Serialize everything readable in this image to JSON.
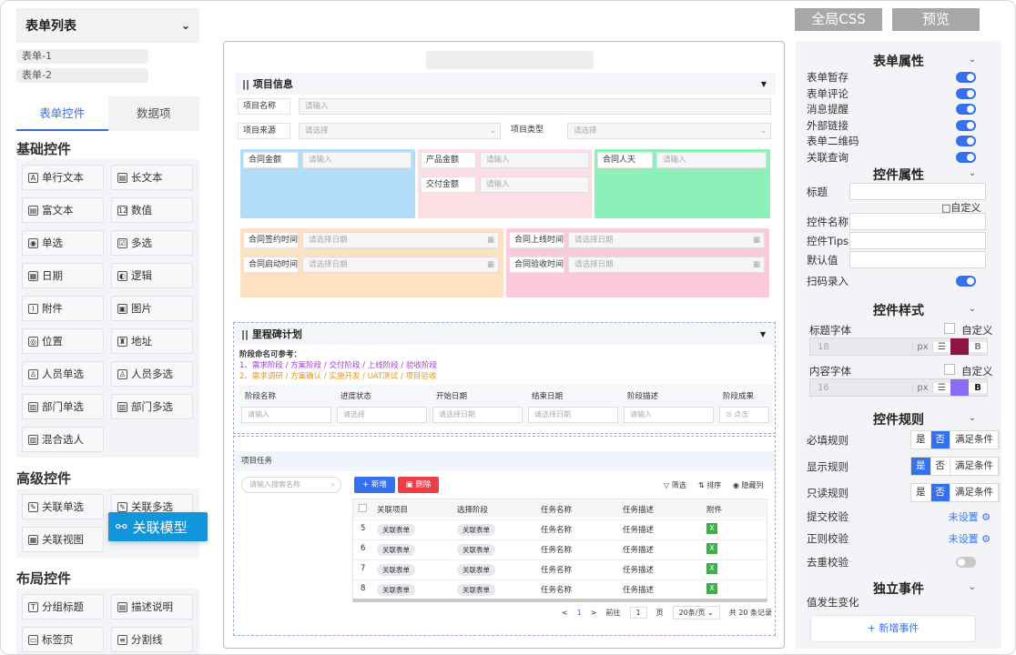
{
  "left": {
    "title": "表单列表",
    "forms": [
      "表单-1",
      "表单-2"
    ],
    "tabs": [
      "表单控件",
      "数据项"
    ],
    "basic_title": "基础控件",
    "basic": [
      {
        "label": "单行文本",
        "icon": "A"
      },
      {
        "label": "长文本",
        "icon": "▤"
      },
      {
        "label": "富文本",
        "icon": "▤"
      },
      {
        "label": "数值",
        "icon": "12"
      },
      {
        "label": "单选",
        "icon": "◉"
      },
      {
        "label": "多选",
        "icon": "☑"
      },
      {
        "label": "日期",
        "icon": "▦"
      },
      {
        "label": "逻辑",
        "icon": "◐"
      },
      {
        "label": "附件",
        "icon": "⌇"
      },
      {
        "label": "图片",
        "icon": "▣"
      },
      {
        "label": "位置",
        "icon": "◎"
      },
      {
        "label": "地址",
        "icon": "♜"
      },
      {
        "label": "人员单选",
        "icon": "♙"
      },
      {
        "label": "人员多选",
        "icon": "♙"
      },
      {
        "label": "部门单选",
        "icon": "▥"
      },
      {
        "label": "部门多选",
        "icon": "▥"
      },
      {
        "label": "混合选人",
        "icon": "▥"
      }
    ],
    "adv_title": "高级控件",
    "advanced": [
      {
        "label": "关联单选",
        "icon": "✎"
      },
      {
        "label": "关联多选",
        "icon": "✎"
      },
      {
        "label": "关联视图",
        "icon": "▦"
      }
    ],
    "dragging": "关联模型",
    "layout_title": "布局控件",
    "layout": [
      {
        "label": "分组标题",
        "icon": "T"
      },
      {
        "label": "描述说明",
        "icon": "▤"
      },
      {
        "label": "标签页",
        "icon": "▭"
      },
      {
        "label": "分割线",
        "icon": "≡"
      }
    ]
  },
  "top": {
    "css_btn": "全局CSS",
    "preview_btn": "预览"
  },
  "canvas": {
    "sec1": "|| 项目信息",
    "project_name": "项目名称",
    "project_source": "项目来源",
    "project_type": "项目类型",
    "ph_input": "请输入",
    "ph_select": "请选择",
    "ph_date": "请选择日期",
    "contract_amount": "合同金额",
    "product_amount": "产品金额",
    "delivery_amount": "交付金额",
    "contract_days": "合同人天",
    "sign_time": "合同签约时间",
    "online_time": "合同上线时间",
    "start_time": "合同启动时间",
    "accept_time": "合同验收时间",
    "sec2": "|| 里程碑计划",
    "stage_ref": "阶段命名可参考：",
    "stage_ref1": "1、需求阶段 / 方案阶段 / 交付阶段 / 上线阶段 / 验收阶段",
    "stage_ref2": "2、需求调研 / 方案确认 / 实施开发 / UAT测试 / 项目验收",
    "ms_cols": [
      "阶段名称",
      "进度状态",
      "开始日期",
      "结束日期",
      "阶段描述",
      "阶段成果"
    ],
    "ms_ph": [
      "请输入",
      "请选择",
      "请选择日期",
      "请选择日期",
      "请输入",
      "⊙ 点击"
    ],
    "task_title": "项目任务",
    "search_ph": "请输入搜索名称",
    "btn_add": "+ 新增",
    "btn_del": "▣ 删除",
    "filter": "▽ 筛选",
    "sort": "⇅ 排序",
    "hidecol": "◉ 隐藏列",
    "task_cols": [
      "关联项目",
      "选择阶段",
      "任务名称",
      "任务描述",
      "附件"
    ],
    "rows": [
      {
        "no": "5",
        "proj": "关联表单",
        "stage": "关联表单",
        "name": "任务名称",
        "desc": "任务描述"
      },
      {
        "no": "6",
        "proj": "关联表单",
        "stage": "关联表单",
        "name": "任务名称",
        "desc": "任务描述"
      },
      {
        "no": "7",
        "proj": "关联表单",
        "stage": "关联表单",
        "name": "任务名称",
        "desc": "任务描述"
      },
      {
        "no": "8",
        "proj": "关联表单",
        "stage": "关联表单",
        "name": "任务名称",
        "desc": "任务描述"
      }
    ],
    "pager": {
      "prev": "<",
      "page": "1",
      "next": ">",
      "goto": "前往",
      "goto_val": "1",
      "page_unit": "页",
      "per_page": "20条/页",
      "total": "共 20 条记录"
    }
  },
  "right": {
    "form_props": "表单属性",
    "toggles": [
      "表单暂存",
      "表单评论",
      "消息提醒",
      "外部链接",
      "表单二维码",
      "关联查询"
    ],
    "ctl_props": "控件属性",
    "title_lbl": "标题",
    "custom": "□自定义",
    "fields": [
      "控件名称",
      "控件Tips",
      "默认值"
    ],
    "scan": "扫码录入",
    "ctl_style": "控件样式",
    "title_font": "标题字体",
    "content_font": "内容字体",
    "custom2": "自定义",
    "title_size": "18",
    "content_size": "16",
    "px": "px",
    "bold": "B",
    "title_color": "#8b1544",
    "content_color": "#8a6cf5",
    "ctl_rules": "控件规则",
    "rules": [
      "必填规则",
      "显示规则",
      "只读规则"
    ],
    "seg": [
      "是",
      "否",
      "满足条件"
    ],
    "submit_check": "提交校验",
    "regex_check": "正则校验",
    "not_set": "未设置 ⚙",
    "dedupe": "去重校验",
    "events": "独立事件",
    "value_change": "值发生变化",
    "add_event": "+ 新增事件"
  }
}
